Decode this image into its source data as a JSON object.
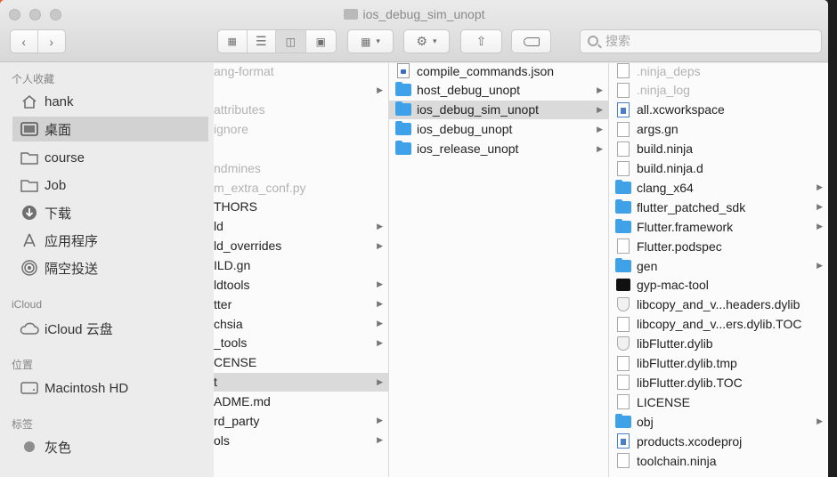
{
  "window": {
    "title": "ios_debug_sim_unopt",
    "accent": "#3fa2e8",
    "selection": "#dadada"
  },
  "toolbar": {
    "back_icon": "chevron-left-icon",
    "forward_icon": "chevron-right-icon",
    "view_modes": [
      "icon-view",
      "list-view",
      "column-view",
      "gallery-view"
    ],
    "active_view": "column-view",
    "search_placeholder": "搜索"
  },
  "sidebar": {
    "favorites_header": "个人收藏",
    "favorites": [
      {
        "label": "hank",
        "icon": "home-icon"
      },
      {
        "label": "桌面",
        "icon": "desktop-icon",
        "selected": true
      },
      {
        "label": "course",
        "icon": "folder-icon"
      },
      {
        "label": "Job",
        "icon": "folder-icon"
      },
      {
        "label": "下载",
        "icon": "download-icon"
      },
      {
        "label": "应用程序",
        "icon": "applications-icon"
      },
      {
        "label": "隔空投送",
        "icon": "airdrop-icon"
      }
    ],
    "icloud_header": "iCloud",
    "icloud": [
      {
        "label": "iCloud 云盘",
        "icon": "cloud-icon"
      }
    ],
    "locations_header": "位置",
    "locations": [
      {
        "label": "Macintosh HD",
        "icon": "disk-icon"
      }
    ],
    "tags_header": "标签",
    "tags": [
      {
        "label": "灰色",
        "color": "#8e8e8e"
      }
    ]
  },
  "column1": {
    "items": [
      {
        "label": "ang-format",
        "dim": true
      },
      {
        "label": "",
        "dim": true,
        "chevron": true
      },
      {
        "label": "attributes",
        "dim": true
      },
      {
        "label": "ignore",
        "dim": true
      },
      {
        "label": "",
        "dim": true
      },
      {
        "label": "ndmines",
        "dim": true
      },
      {
        "label": "m_extra_conf.py",
        "dim": true
      },
      {
        "label": "THORS"
      },
      {
        "label": "ld",
        "chevron": true
      },
      {
        "label": "ld_overrides",
        "chevron": true
      },
      {
        "label": "ILD.gn"
      },
      {
        "label": "ldtools",
        "chevron": true
      },
      {
        "label": "tter",
        "chevron": true
      },
      {
        "label": "chsia",
        "chevron": true
      },
      {
        "label": "_tools",
        "chevron": true
      },
      {
        "label": "CENSE"
      },
      {
        "label": "t",
        "chevron": true,
        "selected": true
      },
      {
        "label": "ADME.md"
      },
      {
        "label": "rd_party",
        "chevron": true
      },
      {
        "label": "ols",
        "chevron": true
      }
    ]
  },
  "column2": {
    "items": [
      {
        "label": "compile_commands.json",
        "icon": "json"
      },
      {
        "label": "host_debug_unopt",
        "icon": "folder",
        "chevron": true
      },
      {
        "label": "ios_debug_sim_unopt",
        "icon": "folder",
        "chevron": true,
        "selected": true
      },
      {
        "label": "ios_debug_unopt",
        "icon": "folder",
        "chevron": true
      },
      {
        "label": "ios_release_unopt",
        "icon": "folder",
        "chevron": true
      }
    ]
  },
  "column3": {
    "items": [
      {
        "label": ".ninja_deps",
        "icon": "doc",
        "dim": true
      },
      {
        "label": ".ninja_log",
        "icon": "doc",
        "dim": true
      },
      {
        "label": "all.xcworkspace",
        "icon": "docblue"
      },
      {
        "label": "args.gn",
        "icon": "doc"
      },
      {
        "label": "build.ninja",
        "icon": "doc"
      },
      {
        "label": "build.ninja.d",
        "icon": "doc"
      },
      {
        "label": "clang_x64",
        "icon": "folder",
        "chevron": true
      },
      {
        "label": "flutter_patched_sdk",
        "icon": "folder",
        "chevron": true
      },
      {
        "label": "Flutter.framework",
        "icon": "folder",
        "chevron": true
      },
      {
        "label": "Flutter.podspec",
        "icon": "doc"
      },
      {
        "label": "gen",
        "icon": "folder",
        "chevron": true
      },
      {
        "label": "gyp-mac-tool",
        "icon": "term"
      },
      {
        "label": "libcopy_and_v...headers.dylib",
        "icon": "shield"
      },
      {
        "label": "libcopy_and_v...ers.dylib.TOC",
        "icon": "doc"
      },
      {
        "label": "libFlutter.dylib",
        "icon": "shield"
      },
      {
        "label": "libFlutter.dylib.tmp",
        "icon": "doc"
      },
      {
        "label": "libFlutter.dylib.TOC",
        "icon": "doc"
      },
      {
        "label": "LICENSE",
        "icon": "doc"
      },
      {
        "label": "obj",
        "icon": "folder",
        "chevron": true
      },
      {
        "label": "products.xcodeproj",
        "icon": "docblue"
      },
      {
        "label": "toolchain.ninja",
        "icon": "doc"
      }
    ]
  }
}
